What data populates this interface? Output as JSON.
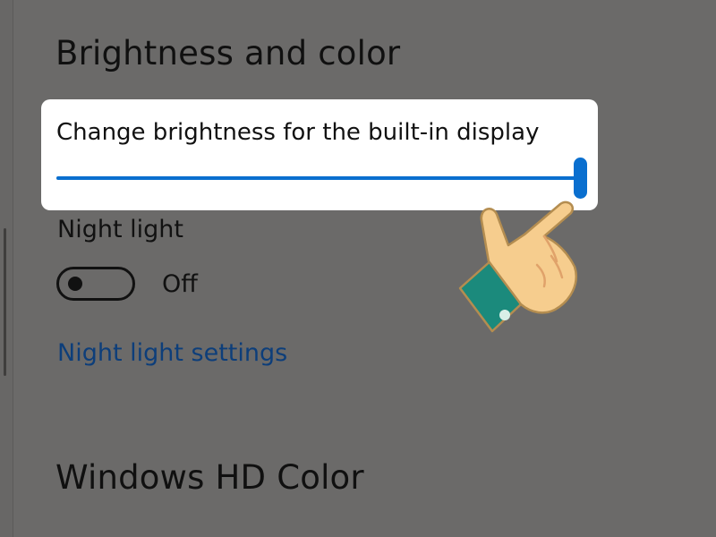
{
  "sections": {
    "brightness_title": "Brightness and color",
    "hdr_title": "Windows HD Color"
  },
  "brightness": {
    "label": "Change brightness for the built-in display",
    "value_percent": 100,
    "accent_color": "#0a6fcf"
  },
  "night_light": {
    "label": "Night light",
    "toggle_state": "Off",
    "toggle_on": false,
    "settings_link": "Night light settings"
  },
  "overlay": {
    "pointer_icon": "pointing-hand-icon"
  }
}
